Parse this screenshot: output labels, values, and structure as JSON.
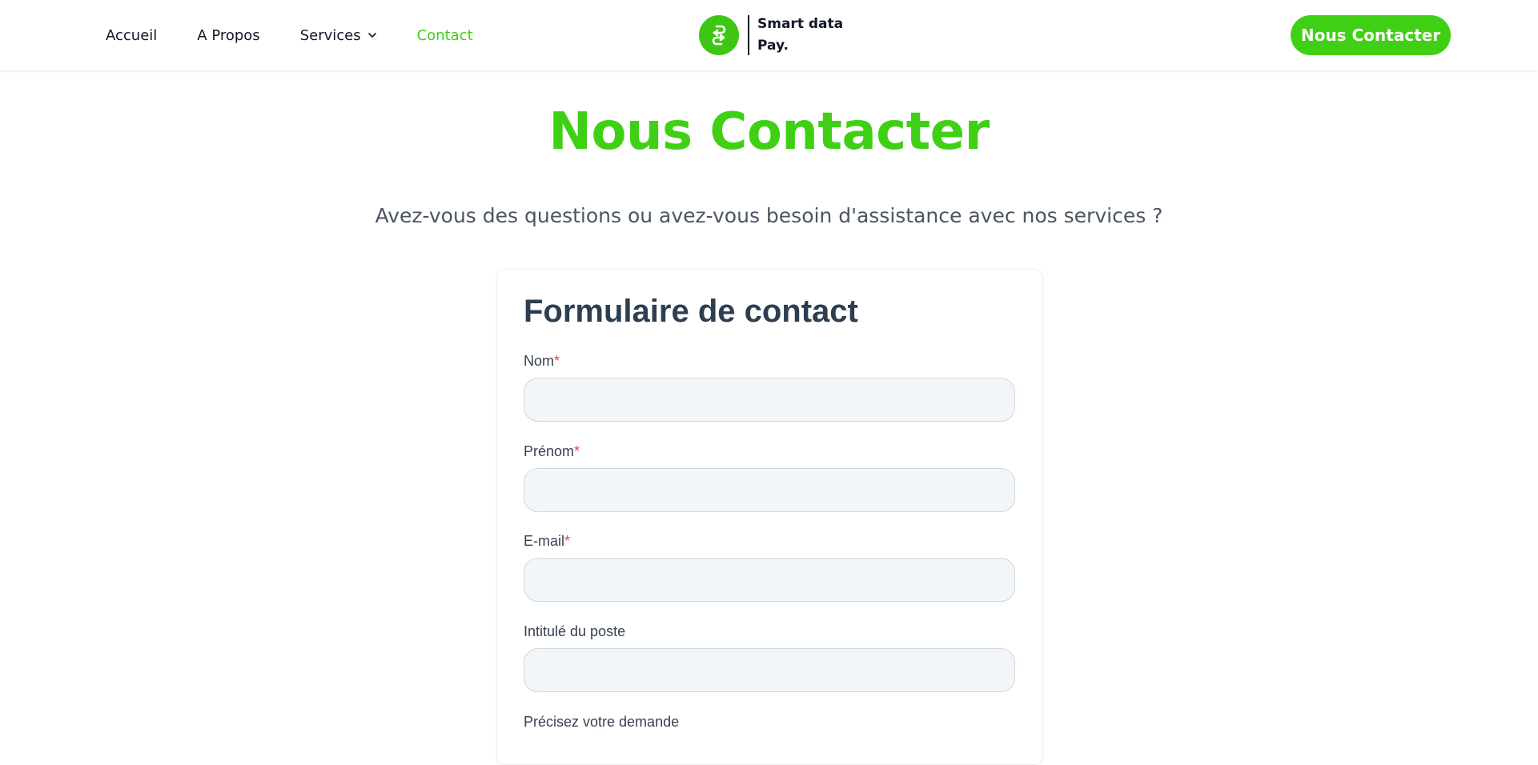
{
  "nav": {
    "links": [
      {
        "label": "Accueil"
      },
      {
        "label": "A Propos"
      },
      {
        "label": "Services"
      },
      {
        "label": "Contact"
      }
    ],
    "active": "Contact",
    "accent_color": "#3fd015"
  },
  "brand": {
    "line1": "Smart data",
    "line2": "Pay.",
    "logo_icon": "swap-arrows-icon"
  },
  "cta": {
    "label": "Nous Contacter"
  },
  "hero": {
    "title": "Nous Contacter",
    "subtitle": "Avez-vous des questions ou avez-vous besoin d'assistance avec nos services ?"
  },
  "form": {
    "title": "Formulaire de contact",
    "fields": [
      {
        "label": "Nom",
        "required_mark": "*",
        "value": ""
      },
      {
        "label": "Prénom",
        "required_mark": "*",
        "value": ""
      },
      {
        "label": "E-mail",
        "required_mark": "*",
        "value": ""
      },
      {
        "label": "Intitulé du poste",
        "required_mark": "",
        "value": ""
      },
      {
        "label": "Précisez votre demande",
        "required_mark": ""
      }
    ]
  }
}
